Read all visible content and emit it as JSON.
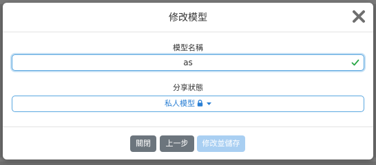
{
  "modal": {
    "title": "修改模型",
    "close_icon": "close-icon"
  },
  "form": {
    "name_label": "模型名稱",
    "name_value": "as",
    "name_valid_icon": "check-icon",
    "status_label": "分享狀態",
    "status_selected": "私人模型",
    "status_icon": "lock-icon",
    "status_caret_icon": "caret-down-icon"
  },
  "footer": {
    "close_label": "關閉",
    "prev_label": "上一步",
    "save_label": "修改並儲存"
  },
  "colors": {
    "primary": "#2a7fd4",
    "input_focus_border": "#5aa7e0",
    "valid_check": "#28a745",
    "secondary_button": "#6c757d",
    "disabled_primary_button": "#a9cff2"
  }
}
